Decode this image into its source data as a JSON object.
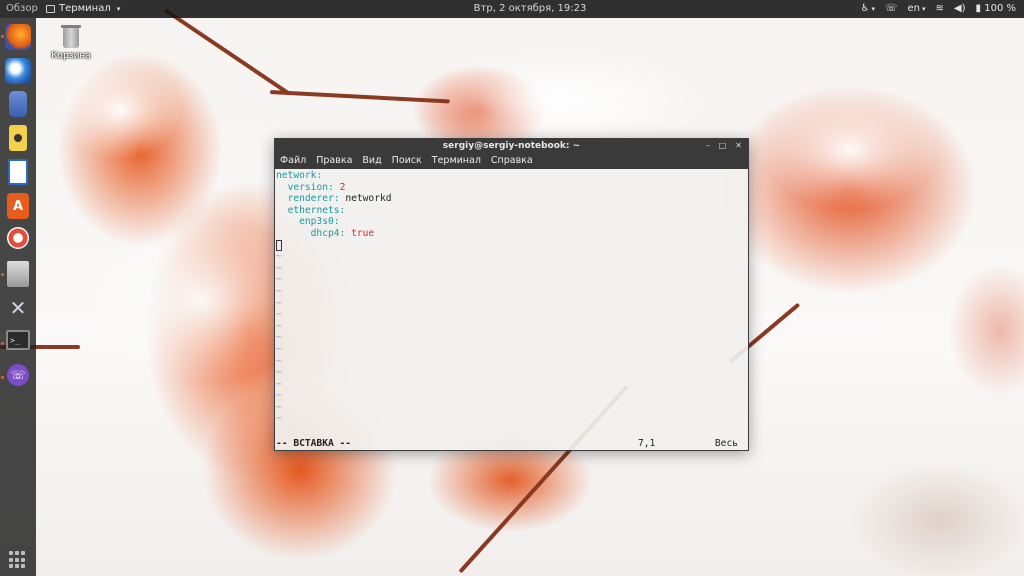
{
  "topbar": {
    "activities": "Обзор",
    "app_menu": "Терминал",
    "clock": "Втр, 2 октября, 19:23",
    "language": "en",
    "battery": "100 %"
  },
  "dock": {
    "items": [
      {
        "name": "firefox-icon",
        "glyph": "🦊"
      },
      {
        "name": "thunderbird-icon",
        "glyph": "✉"
      },
      {
        "name": "files-icon",
        "glyph": "🗂"
      },
      {
        "name": "rhythmbox-icon",
        "glyph": "◉"
      },
      {
        "name": "libreoffice-writer-icon",
        "glyph": "▤"
      },
      {
        "name": "software-center-icon",
        "glyph": "A"
      },
      {
        "name": "help-icon",
        "glyph": "⊕"
      },
      {
        "name": "system-settings-icon",
        "glyph": "▦"
      },
      {
        "name": "tools-icon",
        "glyph": "✕"
      },
      {
        "name": "terminal-icon",
        "glyph": ">_"
      },
      {
        "name": "viber-icon",
        "glyph": "☏"
      }
    ]
  },
  "desktop": {
    "trash_label": "Корзина"
  },
  "terminal": {
    "title": "sergiy@sergiy-notebook: ~",
    "menu": [
      "Файл",
      "Правка",
      "Вид",
      "Поиск",
      "Терминал",
      "Справка"
    ],
    "lines": [
      {
        "indent": "",
        "key": "network:",
        "value": ""
      },
      {
        "indent": "  ",
        "key": "version:",
        "value": "2",
        "value_type": "num"
      },
      {
        "indent": "  ",
        "key": "renderer:",
        "value": "networkd",
        "value_type": "val"
      },
      {
        "indent": "  ",
        "key": "ethernets:",
        "value": ""
      },
      {
        "indent": "    ",
        "key": "enp3s0:",
        "value": ""
      },
      {
        "indent": "      ",
        "key": "dhcp4:",
        "value": "true",
        "value_type": "bool"
      }
    ],
    "tilde_char": "~",
    "status": {
      "mode": "-- ВСТАВКА --",
      "position": "7,1",
      "scroll": "Весь"
    }
  }
}
